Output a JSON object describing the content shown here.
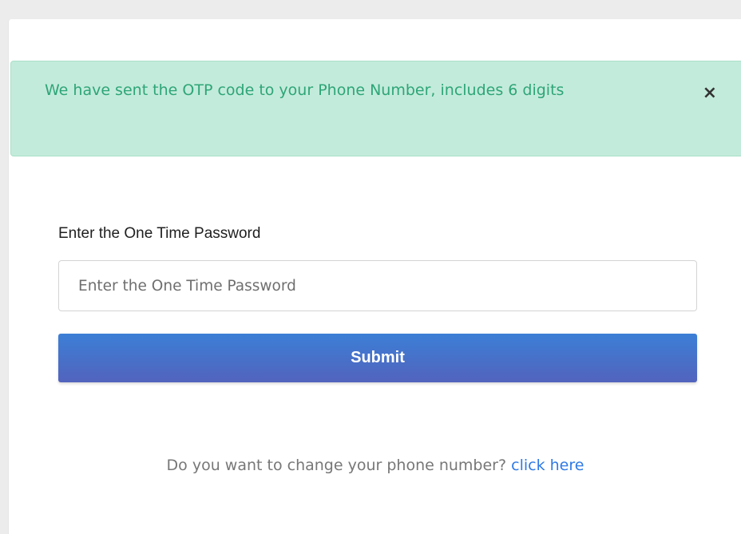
{
  "alert": {
    "message": "We have sent the OTP code to your Phone Number, includes 6 digits",
    "close_symbol": "×"
  },
  "form": {
    "label": "Enter the One Time Password",
    "input_placeholder": "Enter the One Time Password",
    "input_value": "",
    "submit_label": "Submit"
  },
  "footer": {
    "question": "Do you want to change your phone number?",
    "link_label": "click here"
  },
  "colors": {
    "alert_background": "#c3ebdb",
    "alert_text": "#2ea578",
    "button_gradient_top": "#3c7fd6",
    "button_gradient_bottom": "#5263bd",
    "link": "#2f7ae5"
  }
}
